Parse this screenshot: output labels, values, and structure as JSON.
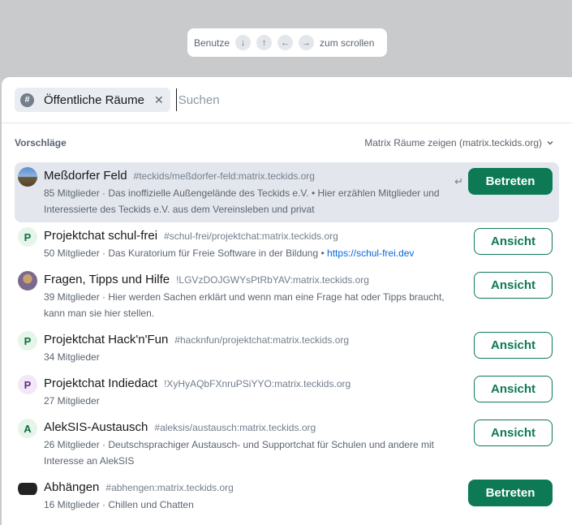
{
  "hint": {
    "prefix": "Benutze",
    "keys": [
      "↓",
      "↑",
      "←",
      "→"
    ],
    "suffix": "zum scrollen"
  },
  "search": {
    "chip_label": "Öffentliche Räume",
    "chip_icon": "#",
    "placeholder": "Suchen"
  },
  "section": {
    "title": "Vorschläge",
    "server_select": "Matrix Räume zeigen (matrix.teckids.org)"
  },
  "rooms": [
    {
      "name": "Meßdorfer Feld",
      "alias": "#teckids/meßdorfer-feld:matrix.teckids.org",
      "members": "85 Mitglieder",
      "topic": "Das inoffizielle Außengelände des Teckids e.V. • Hier erzählen Mitglieder und Interessierte des Teckids e.V. aus dem Vereinsleben und privat",
      "link": "",
      "action": "Betreten",
      "avatar": "field-photo",
      "avatar_letter": ""
    },
    {
      "name": "Projektchat schul-frei",
      "alias": "#schul-frei/projektchat:matrix.teckids.org",
      "members": "50 Mitglieder",
      "topic": "Das Kuratorium für Freie Software in der Bildung •",
      "link": "https://schul-frei.dev",
      "action": "Ansicht",
      "avatar": "letter",
      "avatar_letter": "P"
    },
    {
      "name": "Fragen, Tipps und Hilfe",
      "alias": "!LGVzDOJGWYsPtRbYAV:matrix.teckids.org",
      "members": "39 Mitglieder",
      "topic": "Hier werden Sachen erklärt und wenn man eine Frage hat oder Tipps braucht, kann man sie hier stellen.",
      "link": "",
      "action": "Ansicht",
      "avatar": "person-photo",
      "avatar_letter": ""
    },
    {
      "name": "Projektchat Hack'n'Fun",
      "alias": "#hacknfun/projektchat:matrix.teckids.org",
      "members": "34 Mitglieder",
      "topic": "",
      "link": "",
      "action": "Ansicht",
      "avatar": "letter",
      "avatar_letter": "P"
    },
    {
      "name": "Projektchat Indiedact",
      "alias": "!XyHyAQbFXnruPSiYYO:matrix.teckids.org",
      "members": "27 Mitglieder",
      "topic": "",
      "link": "",
      "action": "Ansicht",
      "avatar": "letter-purple",
      "avatar_letter": "P"
    },
    {
      "name": "AlekSIS-Austausch",
      "alias": "#aleksis/austausch:matrix.teckids.org",
      "members": "26 Mitglieder",
      "topic": "Deutschsprachiger Austausch- und Supportchat für Schulen und andere mit Interesse an AlekSIS",
      "link": "",
      "action": "Ansicht",
      "avatar": "letter",
      "avatar_letter": "A"
    },
    {
      "name": "Abhängen",
      "alias": "#abhengen:matrix.teckids.org",
      "members": "16 Mitglieder",
      "topic": "Chillen und Chatten",
      "link": "",
      "action": "Betreten",
      "avatar": "dark-object",
      "avatar_letter": ""
    }
  ],
  "colors": {
    "accent": "#0d7a55",
    "link": "#0467dd",
    "highlight": "#e3e7ed"
  }
}
